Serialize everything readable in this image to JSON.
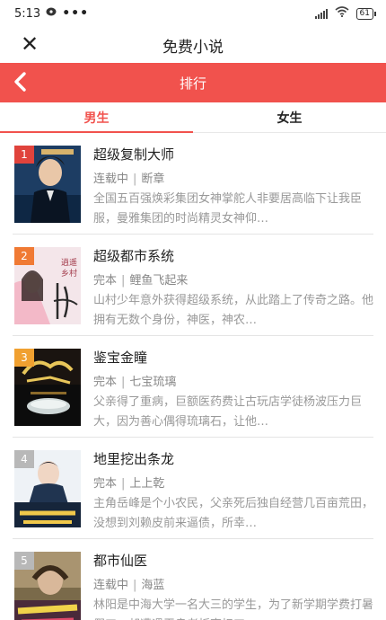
{
  "status_bar": {
    "time": "5:13",
    "battery": "61",
    "icons": [
      "chat-bubble-icon",
      "more-dots-icon",
      "signal-icon",
      "wifi-icon",
      "battery-icon"
    ]
  },
  "title_bar": {
    "close_icon": "close-icon",
    "title": "免费小说"
  },
  "header": {
    "back_icon": "chevron-left-icon",
    "title": "排行",
    "color": "#f1524d"
  },
  "tabs": [
    {
      "label": "男生",
      "active": true
    },
    {
      "label": "女生",
      "active": false
    }
  ],
  "books": [
    {
      "rank": "1",
      "rank_color": "#e0433c",
      "title": "超级复制大师",
      "status": "连载中",
      "author": "断章",
      "desc": "全国五百强焕彩集团女神掌舵人非要居高临下让我臣服，曼雅集团的时尚精灵女神仰…"
    },
    {
      "rank": "2",
      "rank_color": "#f07a34",
      "title": "超级都市系统",
      "status": "完本",
      "author": "鲤鱼飞起来",
      "desc": "山村少年意外获得超级系统，从此踏上了传奇之路。他拥有无数个身份，神医，神农…"
    },
    {
      "rank": "3",
      "rank_color": "#f0a030",
      "title": "鉴宝金瞳",
      "status": "完本",
      "author": "七宝琉璃",
      "desc": "父亲得了重病，巨额医药费让古玩店学徒杨波压力巨大，因为善心偶得琉璃石，让他…"
    },
    {
      "rank": "4",
      "rank_color": "#b8b8b8",
      "title": "地里挖出条龙",
      "status": "完本",
      "author": "上上乾",
      "desc": "主角岳峰是个小农民，父亲死后独自经营几百亩荒田，没想到刘赖皮前来逼债，所幸…"
    },
    {
      "rank": "5",
      "rank_color": "#b8b8b8",
      "title": "都市仙医",
      "status": "连载中",
      "author": "海蓝",
      "desc": "林阳是中海大学一名大三的学生，为了新学期学费打暑假工，却遭遇无良老板克扣工…"
    }
  ]
}
